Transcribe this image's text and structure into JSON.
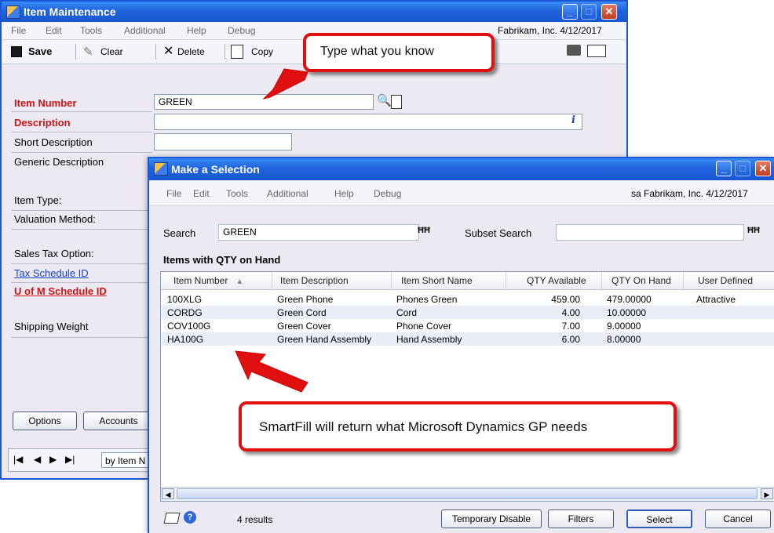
{
  "item_window": {
    "title": "Item Maintenance",
    "menu": [
      "File",
      "Edit",
      "Tools",
      "Additional",
      "Help",
      "Debug"
    ],
    "company_info": "Fabrikam, Inc.  4/12/2017",
    "toolbar": {
      "save": "Save",
      "clear": "Clear",
      "delete": "Delete",
      "copy": "Copy"
    },
    "fields": {
      "item_number_label": "Item Number",
      "item_number_value": "GREEN",
      "description_label": "Description",
      "short_description_label": "Short Description",
      "generic_description_label": "Generic Description",
      "item_type_label": "Item Type:",
      "valuation_method_label": "Valuation Method:",
      "sales_tax_option_label": "Sales Tax Option:",
      "tax_schedule_id_label": "Tax Schedule ID",
      "uofm_schedule_id_label": "U of M Schedule ID",
      "shipping_weight_label": "Shipping Weight"
    },
    "buttons": {
      "options": "Options",
      "accounts": "Accounts"
    },
    "browse": {
      "sort_by": "by Item N"
    }
  },
  "selection_window": {
    "title": "Make a Selection",
    "menu": [
      "File",
      "Edit",
      "Tools",
      "Additional",
      "Help",
      "Debug"
    ],
    "company_info": "sa  Fabrikam, Inc.  4/12/2017",
    "search_label": "Search",
    "search_value": "GREEN",
    "subset_search_label": "Subset Search",
    "subset_search_value": "",
    "list_title": "Items with QTY on Hand",
    "columns": [
      "Item Number",
      "Item Description",
      "Item Short Name",
      "QTY Available",
      "QTY On Hand",
      "User Defined"
    ],
    "rows": [
      {
        "item_number": "100XLG",
        "description": "Green Phone",
        "short_name": "Phones Green",
        "qty_available": "459.00",
        "qty_on_hand": "479.00000",
        "user_defined": "Attractive"
      },
      {
        "item_number": "CORDG",
        "description": "Green Cord",
        "short_name": "Cord",
        "qty_available": "4.00",
        "qty_on_hand": "10.00000",
        "user_defined": ""
      },
      {
        "item_number": "COV100G",
        "description": "Green Cover",
        "short_name": "Phone Cover",
        "qty_available": "7.00",
        "qty_on_hand": "9.00000",
        "user_defined": ""
      },
      {
        "item_number": "HA100G",
        "description": "Green Hand Assembly",
        "short_name": "Hand Assembly",
        "qty_available": "6.00",
        "qty_on_hand": "8.00000",
        "user_defined": ""
      }
    ],
    "results_count": "4 results",
    "buttons": {
      "temporary_disable": "Temporary Disable",
      "filters": "Filters",
      "select": "Select",
      "cancel": "Cancel"
    }
  },
  "callouts": {
    "top": "Type what you know",
    "bottom": "SmartFill will return what Microsoft Dynamics GP needs"
  },
  "colors": {
    "titlebar": "#1f63de",
    "required_label": "#d21414",
    "link_label": "#1b3fc4",
    "callout_border": "#e01010",
    "row_alt": "#e9eef9",
    "window_bg": "#ece9f2"
  }
}
